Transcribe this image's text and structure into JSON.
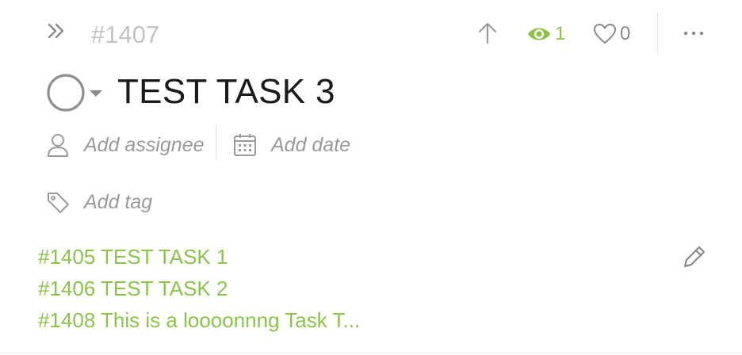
{
  "task": {
    "id": "#1407",
    "title": "TEST TASK 3"
  },
  "header": {
    "expand_icon": "double-chevron-right-icon",
    "upload_icon": "arrow-up-icon",
    "watchers_icon": "eye-icon",
    "watchers_count": "1",
    "likes_icon": "heart-icon",
    "likes_count": "0",
    "more_icon": "ellipsis-icon"
  },
  "meta": {
    "assignee_label": "Add assignee",
    "assignee_icon": "user-icon",
    "date_label": "Add date",
    "date_icon": "calendar-icon",
    "tag_label": "Add tag",
    "tag_icon": "tag-icon"
  },
  "linked_tasks": [
    "#1405 TEST TASK 1",
    "#1406 TEST TASK 2",
    "#1408 This is a loooonnng Task T..."
  ],
  "colors": {
    "accent_green": "#8bc34a",
    "muted_gray": "#9a9a9a",
    "id_gray": "#c2c2c2"
  }
}
